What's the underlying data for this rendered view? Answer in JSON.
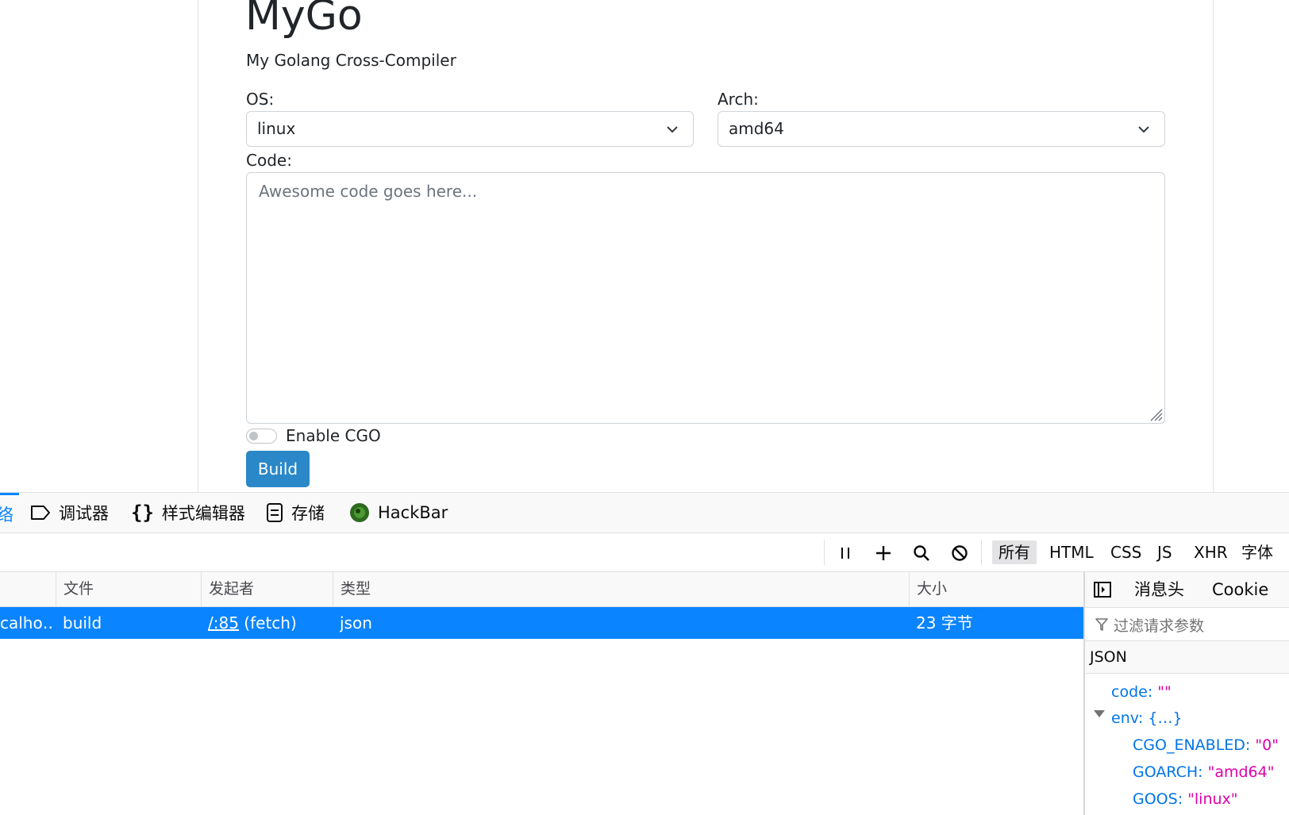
{
  "page": {
    "title": "MyGo",
    "subtitle": "My Golang Cross-Compiler",
    "os_label": "OS:",
    "os_value": "linux",
    "arch_label": "Arch:",
    "arch_value": "amd64",
    "code_label": "Code:",
    "code_placeholder": "Awesome code goes here...",
    "cgo_label": "Enable CGO",
    "cgo_enabled": false,
    "build_label": "Build",
    "build_color": "#2b88c8"
  },
  "devtools": {
    "partial_tab": "络",
    "tabs": [
      {
        "label": "调试器",
        "icon": "debugger-icon"
      },
      {
        "label": "样式编辑器",
        "icon": "style-editor-icon"
      },
      {
        "label": "存储",
        "icon": "storage-icon"
      },
      {
        "label": "HackBar",
        "icon": "hackbar-icon"
      }
    ],
    "toolbar": {
      "pause_icon": "pause-icon",
      "add_icon": "plus-icon",
      "search_icon": "search-icon",
      "block_icon": "block-icon",
      "filters": [
        "所有",
        "HTML",
        "CSS",
        "JS",
        "XHR",
        "字体"
      ],
      "active_filter": "所有"
    },
    "table": {
      "headers": [
        "文件",
        "发起者",
        "类型",
        "大小"
      ],
      "rows": [
        {
          "domain": "calho…",
          "file": "build",
          "initiator_link": "/:85",
          "initiator_rest": " (fetch)",
          "type": "json",
          "size": "23 字节"
        }
      ]
    },
    "sidebar": {
      "tabs": [
        "消息头",
        "Cookie"
      ],
      "filter_placeholder": "过滤请求参数",
      "section": "JSON",
      "json": {
        "code_key": "code:",
        "code_val": "\"\"",
        "env_key": "env:",
        "env_val": "{…}",
        "cgo_key": "CGO_ENABLED:",
        "cgo_val": "\"0\"",
        "goarch_key": "GOARCH:",
        "goarch_val": "\"amd64\"",
        "goos_key": "GOOS:",
        "goos_val": "\"linux\""
      }
    },
    "colors": {
      "selected_row": "#0a84ff",
      "json_key": "#0074e8",
      "json_string": "#dd00a9"
    }
  }
}
